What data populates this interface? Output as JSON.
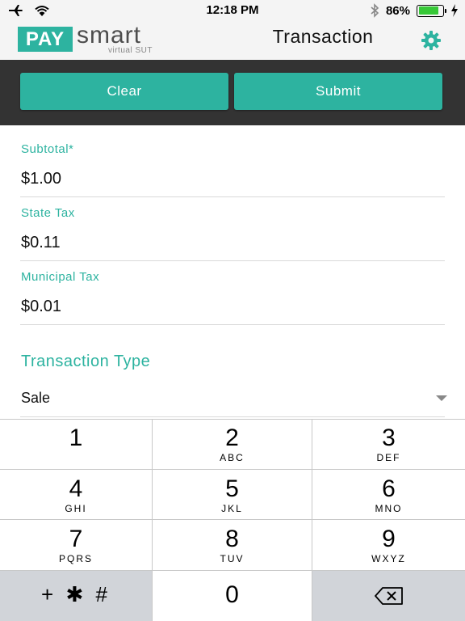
{
  "status_bar": {
    "time": "12:18 PM",
    "battery_percent": "86%",
    "battery_level": 0.86,
    "icons": [
      "airplane-icon",
      "wifi-icon",
      "bluetooth-icon",
      "battery-icon",
      "charging-icon"
    ]
  },
  "header": {
    "logo_pay": "PAY",
    "logo_smart": "smart",
    "logo_sub": "virtual SUT",
    "title": "Transaction",
    "settings_icon": "gear-icon"
  },
  "actions": {
    "clear_label": "Clear",
    "submit_label": "Submit"
  },
  "form": {
    "subtotal_label": "Subtotal*",
    "subtotal_value": "$1.00",
    "state_tax_label": "State Tax",
    "state_tax_value": "$0.11",
    "municipal_tax_label": "Municipal Tax",
    "municipal_tax_value": "$0.01",
    "transaction_type_title": "Transaction Type",
    "transaction_type_value": "Sale"
  },
  "keypad": {
    "keys": [
      {
        "digit": "1",
        "letters": ""
      },
      {
        "digit": "2",
        "letters": "ABC"
      },
      {
        "digit": "3",
        "letters": "DEF"
      },
      {
        "digit": "4",
        "letters": "GHI"
      },
      {
        "digit": "5",
        "letters": "JKL"
      },
      {
        "digit": "6",
        "letters": "MNO"
      },
      {
        "digit": "7",
        "letters": "PQRS"
      },
      {
        "digit": "8",
        "letters": "TUV"
      },
      {
        "digit": "9",
        "letters": "WXYZ"
      },
      {
        "digit": "0",
        "letters": ""
      }
    ],
    "symbols_label": "+ ✱ #",
    "backspace_icon": "backspace-icon"
  },
  "colors": {
    "accent": "#2db3a0",
    "action_bar": "#333333",
    "header_bg": "#f4f4f4",
    "keypad_gray": "#d1d4d9"
  }
}
